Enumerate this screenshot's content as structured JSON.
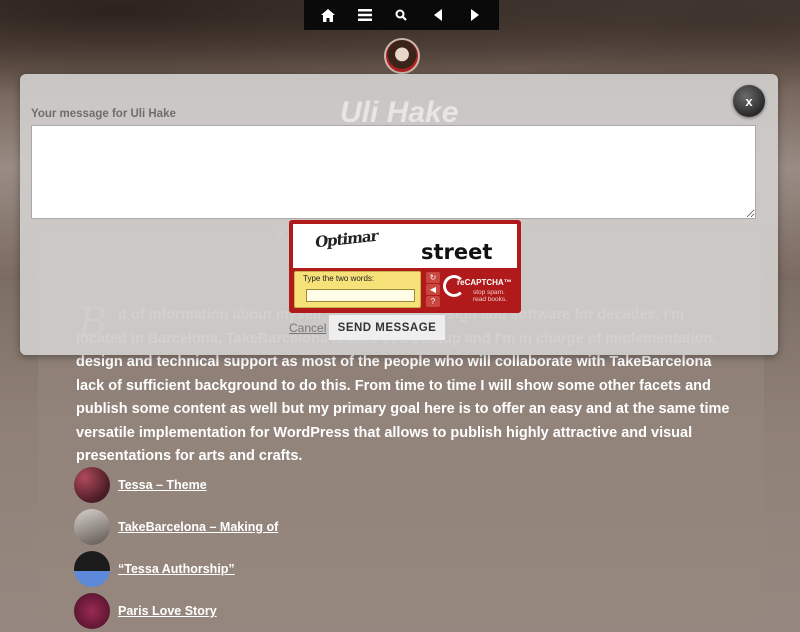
{
  "nav": {
    "home_icon": "home-icon",
    "menu_icon": "menu-icon",
    "search_icon": "search-icon",
    "prev_icon": "prev-icon",
    "next_icon": "next-icon"
  },
  "site": {
    "title": "Uli Hake",
    "subtitle_fragment": "A"
  },
  "article": {
    "text": "it of information about myself. I'm doing web design and software for decades. I'm located in Barcelona. TakeBarcelona is kind of a startup and I'm in charge of implementation, design and technical support as most of the people who will collaborate with TakeBarcelona lack of sufficient background to do this. From time to time I will show some other facets and publish some content as well but my primary goal here is to offer an easy and at the same time versatile implementation for WordPress that allows to publish highly attractive and visual presentations for arts and crafts.",
    "dropcap": "B"
  },
  "related": [
    {
      "label": "Tessa – Theme",
      "thumb_color": "#6d2c3a"
    },
    {
      "label": "TakeBarcelona – Making of",
      "thumb_color": "#9a9490"
    },
    {
      "label": "“Tessa Authorship”",
      "thumb_color": "#3f5c9a"
    },
    {
      "label": "Paris Love Story",
      "thumb_color": "#7a1d3c"
    }
  ],
  "modal": {
    "label": "Your message for Uli Hake",
    "message_value": "",
    "close_label": "x",
    "cancel_label": "Cancel",
    "send_label": "SEND MESSAGE"
  },
  "recaptcha": {
    "word1": "Optimar",
    "word2": "street",
    "prompt": "Type the two words:",
    "input_value": "",
    "brand": "reCAPTCHA™",
    "tagline": "stop spam. read books.",
    "accent_color": "#b01a1a"
  }
}
